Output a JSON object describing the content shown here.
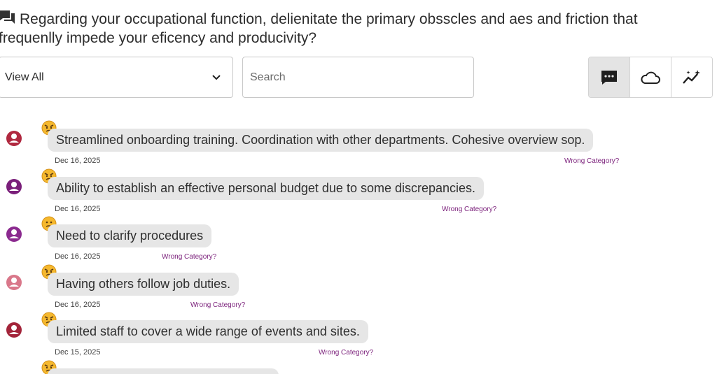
{
  "question": "Regarding your occupational function, delienitate the primary obsscles and aes and friction that frequenlly impede your eficency and producivity?",
  "filter": {
    "selected": "View All"
  },
  "search": {
    "placeholder": "Search"
  },
  "view_modes": [
    "comments-icon",
    "cloud-icon",
    "trend-icon"
  ],
  "colors": {
    "accent": "#7a1f7a",
    "bubble": "#e6e6e6"
  },
  "responses": [
    {
      "text": "Streamlined onboarding training. Coordination with other departments. Cohesive overview sop.",
      "date": "Dec 16, 2025",
      "link": "Wrong Category?",
      "emoji": "angry",
      "avatar_color": "#b0283f"
    },
    {
      "text": "Ability to establish an effective personal budget due to some discrepancies.",
      "date": "Dec 16, 2025",
      "link": "Wrong Category?",
      "emoji": "angry",
      "avatar_color": "#7a1f7a"
    },
    {
      "text": "Need to clarify procedures",
      "date": "Dec 16, 2025",
      "link": "Wrong Category?",
      "emoji": "confused",
      "avatar_color": "#8b2a8f"
    },
    {
      "text": "Having others follow job duties.",
      "date": "Dec 16, 2025",
      "link": "Wrong Category?",
      "emoji": "angry",
      "avatar_color": "#d9778a"
    },
    {
      "text": "Limited staff to cover a wide range of events and sites.",
      "date": "Dec 15, 2025",
      "link": "Wrong Category?",
      "emoji": "angry",
      "avatar_color": "#a3243a"
    }
  ]
}
